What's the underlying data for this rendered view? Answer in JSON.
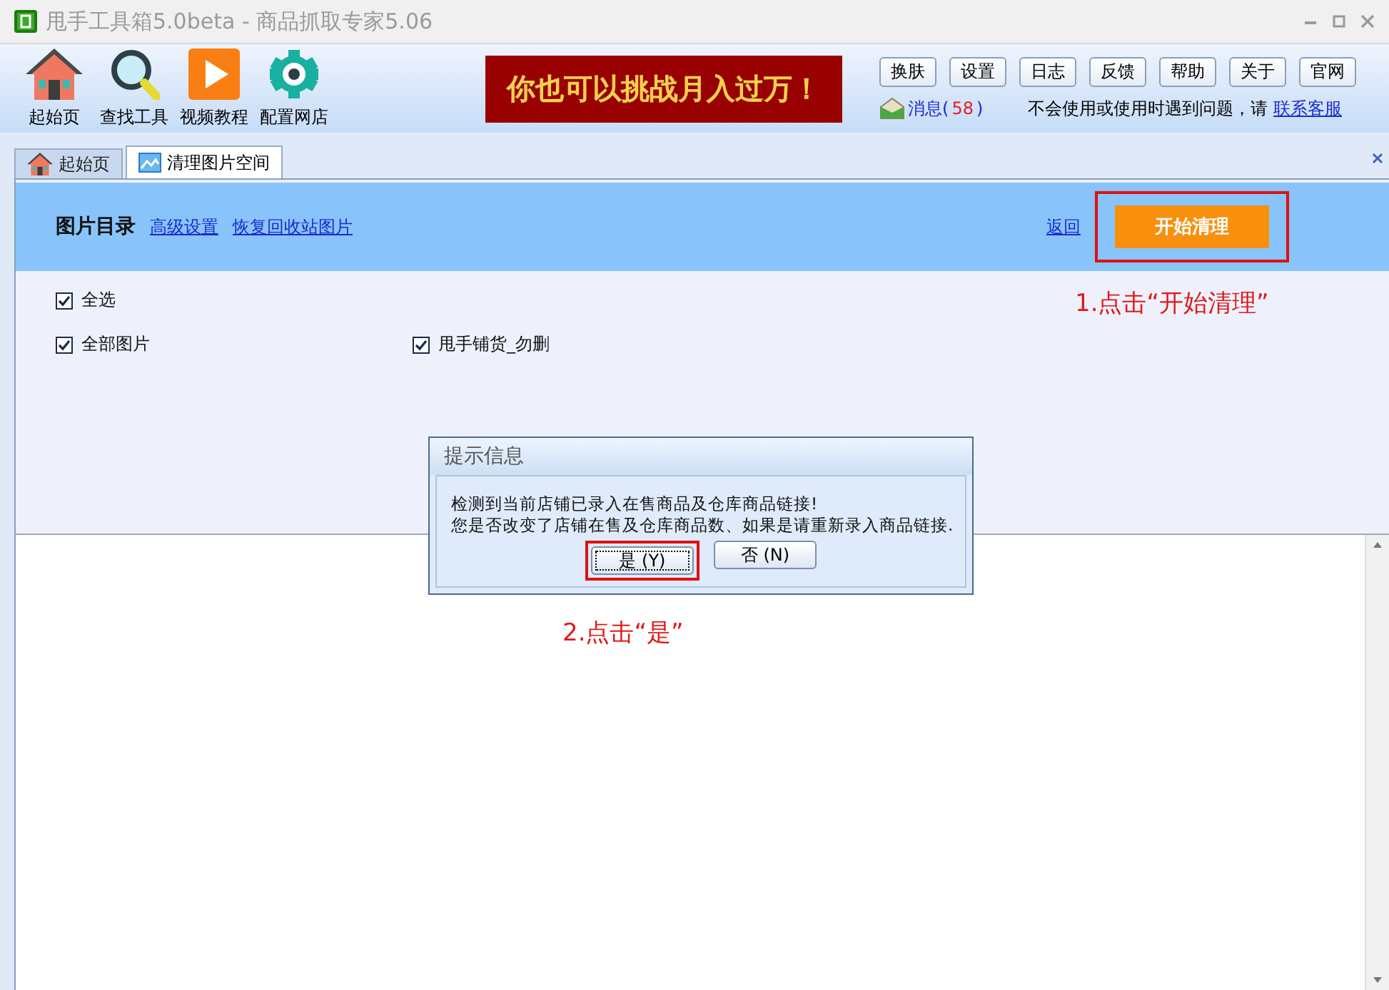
{
  "window": {
    "title": "甩手工具箱5.0beta - 商品抓取专家5.06"
  },
  "toolbar": [
    {
      "label": "起始页",
      "kind": "home"
    },
    {
      "label": "查找工具",
      "kind": "search"
    },
    {
      "label": "视频教程",
      "kind": "video"
    },
    {
      "label": "配置网店",
      "kind": "gear"
    }
  ],
  "banner": {
    "text": "你也可以挑战月入过万！"
  },
  "top_buttons": [
    "换肤",
    "设置",
    "日志",
    "反馈",
    "帮助",
    "关于",
    "官网"
  ],
  "messages": {
    "label": "消息(",
    "count": "58",
    "suffix": ")"
  },
  "help": {
    "text": "不会使用或使用时遇到问题，请",
    "link": "联系客服"
  },
  "tabs": [
    {
      "label": "起始页",
      "selected": false,
      "kind": "home"
    },
    {
      "label": "清理图片空间",
      "selected": true,
      "kind": "image"
    }
  ],
  "panel": {
    "title": "图片目录",
    "links": [
      "高级设置",
      "恢复回收站图片"
    ],
    "back": "返回",
    "start_button": "开始清理"
  },
  "checkboxes": [
    {
      "label": "全选",
      "checked": true
    },
    {
      "label": "全部图片",
      "checked": true
    },
    {
      "label": "甩手铺货_勿删",
      "checked": true
    }
  ],
  "dialog": {
    "title": "提示信息",
    "lines": [
      "检测到当前店铺已录入在售商品及仓库商品链接!",
      "您是否改变了店铺在售及仓库商品数、如果是请重新录入商品链接."
    ],
    "buttons": [
      {
        "label": "是 (Y)",
        "selected": true
      },
      {
        "label": "否 (N)",
        "selected": false
      }
    ]
  },
  "annotations": [
    "1.点击“开始清理”",
    "2.点击“是”"
  ]
}
